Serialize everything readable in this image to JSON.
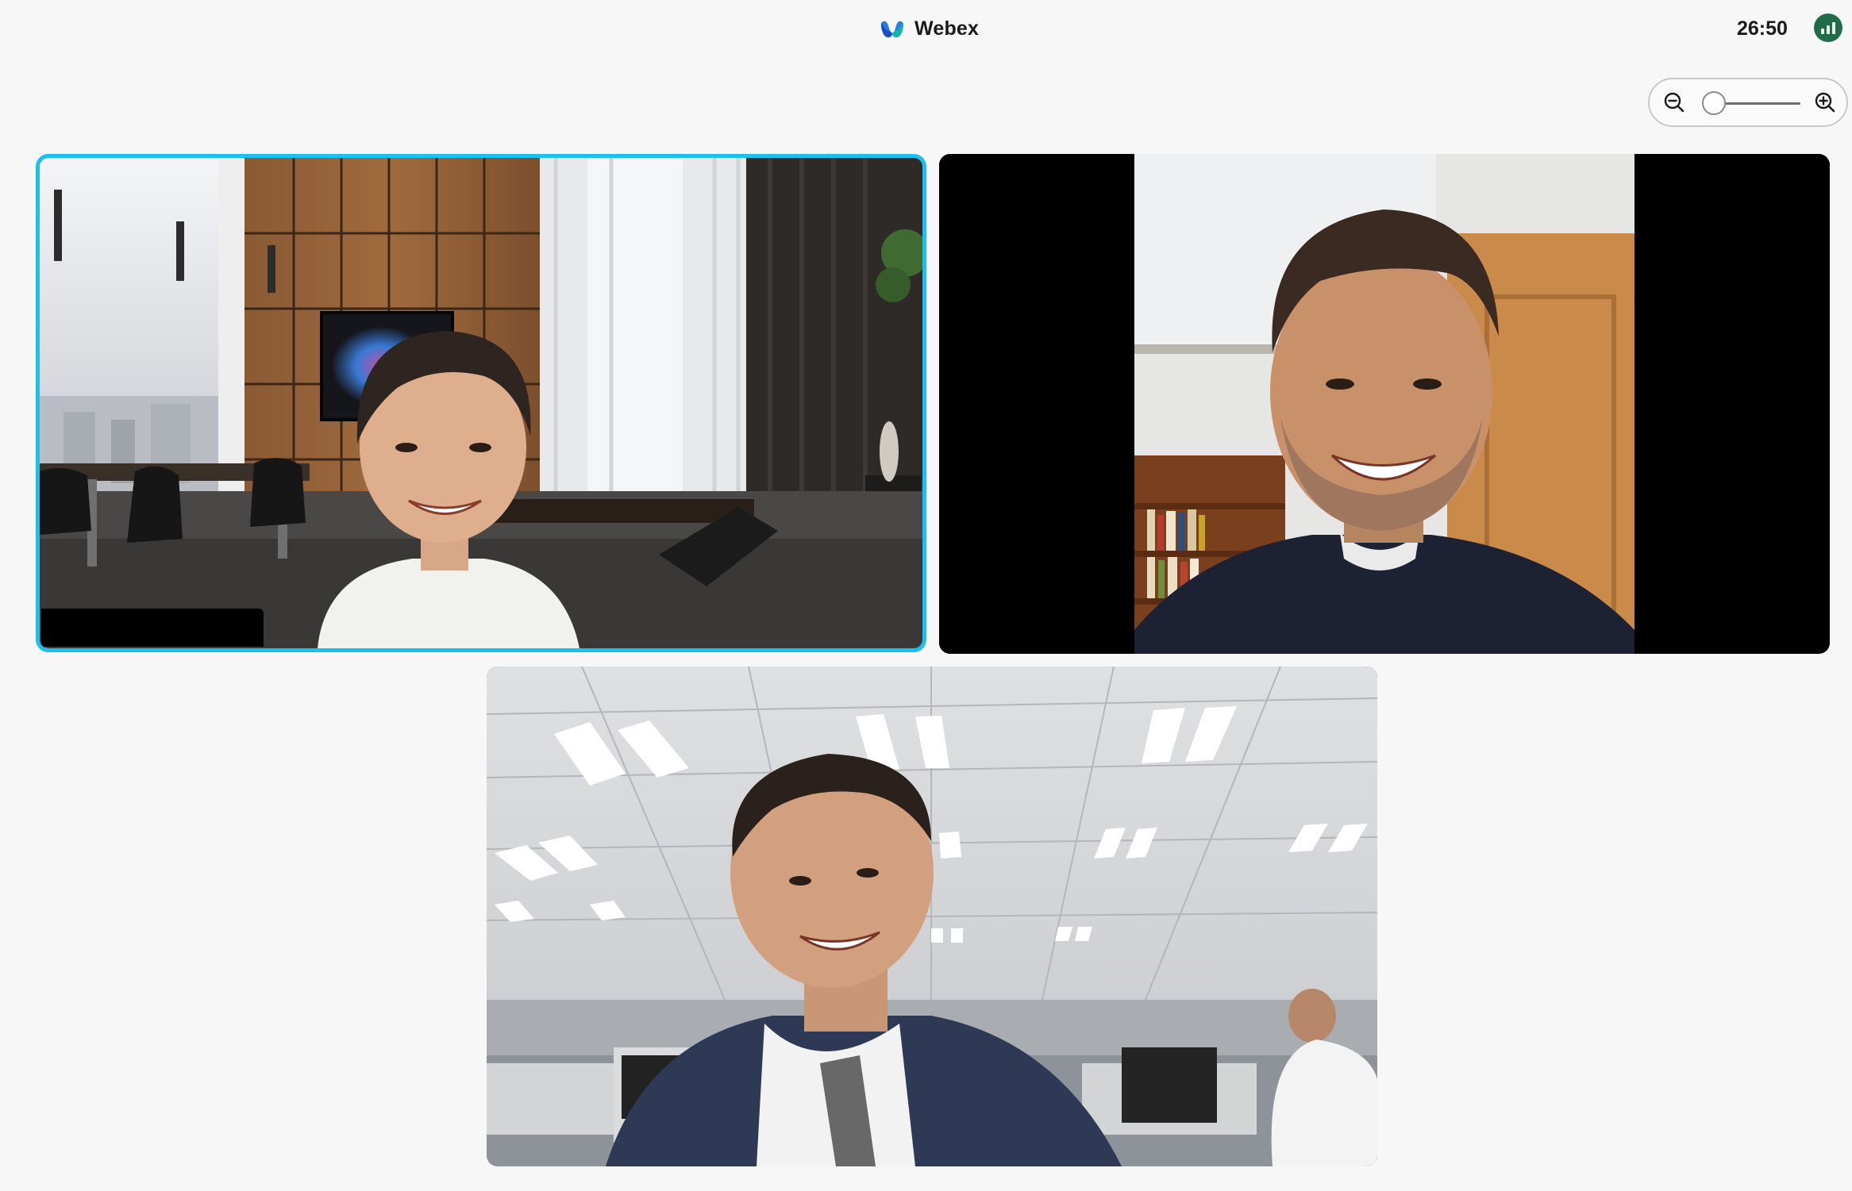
{
  "app": {
    "name": "Webex",
    "timer": "26:50"
  },
  "colors": {
    "active_speaker_border": "#1cc0ee",
    "connection_badge": "#1f6b4a",
    "background": "#f7f7f7"
  },
  "icons": {
    "logo": "webex-logo-icon",
    "connection": "signal-bars-icon",
    "zoom_out": "zoom-out-icon",
    "zoom_in": "zoom-in-icon"
  },
  "zoom": {
    "level": 0.08
  },
  "videos": [
    {
      "active_speaker": true,
      "scene": "office-lounge-virtual-background"
    },
    {
      "active_speaker": false,
      "scene": "home-room-with-bookshelf",
      "letterboxed": true
    },
    {
      "active_speaker": false,
      "scene": "open-plan-office"
    }
  ]
}
